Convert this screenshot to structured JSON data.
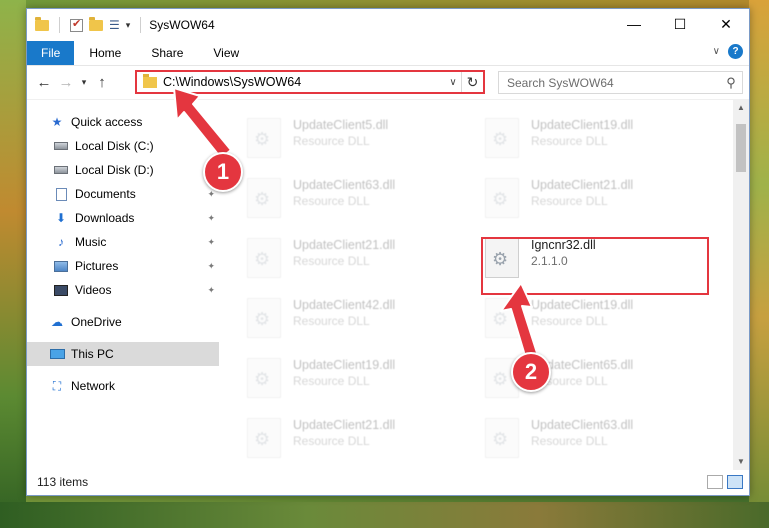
{
  "window": {
    "title": "SysWOW64",
    "minimize_glyph": "—",
    "maximize_glyph": "☐",
    "close_glyph": "✕"
  },
  "ribbon": {
    "tabs": [
      "File",
      "Home",
      "Share",
      "View"
    ],
    "help_glyph": "?",
    "expand_glyph": "∨"
  },
  "navbar": {
    "back_glyph": "←",
    "forward_glyph": "→",
    "recent_glyph": "▾",
    "up_glyph": "↑",
    "address": "C:\\Windows\\SysWOW64",
    "address_dropdown_glyph": "∨",
    "refresh_glyph": "↻",
    "search_placeholder": "Search SysWOW64",
    "search_glyph": "⚲"
  },
  "sidebar": {
    "quick_access": "Quick access",
    "items": [
      {
        "label": "Local Disk (C:)",
        "icon": "disk-icon"
      },
      {
        "label": "Local Disk (D:)",
        "icon": "disk-icon"
      },
      {
        "label": "Documents",
        "icon": "documents-icon",
        "pinned": true
      },
      {
        "label": "Downloads",
        "icon": "downloads-icon",
        "pinned": true
      },
      {
        "label": "Music",
        "icon": "music-icon",
        "pinned": true
      },
      {
        "label": "Pictures",
        "icon": "pictures-icon",
        "pinned": true
      },
      {
        "label": "Videos",
        "icon": "videos-icon",
        "pinned": true
      }
    ],
    "onedrive": "OneDrive",
    "this_pc": "This PC",
    "network": "Network",
    "pin_glyph": "✦"
  },
  "files": {
    "left_column": [
      {
        "name": "UpdateClient5.dll",
        "type": "Resource DLL"
      },
      {
        "name": "UpdateClient63.dll",
        "type": "Resource DLL"
      },
      {
        "name": "UpdateClient21.dll",
        "type": "Resource DLL"
      },
      {
        "name": "UpdateClient42.dll",
        "type": "Resource DLL"
      },
      {
        "name": "UpdateClient19.dll",
        "type": "Resource DLL"
      },
      {
        "name": "UpdateClient21.dll",
        "type": "Resource DLL"
      }
    ],
    "right_column": [
      {
        "name": "UpdateClient19.dll",
        "type": "Resource DLL"
      },
      {
        "name": "UpdateClient21.dll",
        "type": "Resource DLL"
      },
      {
        "name": "Igncnr32.dll",
        "type": "2.1.1.0"
      },
      {
        "name": "UpdateClient19.dll",
        "type": "Resource DLL"
      },
      {
        "name": "UpdateClient65.dll",
        "type": "Resource DLL"
      },
      {
        "name": "UpdateClient63.dll",
        "type": "Resource DLL"
      }
    ]
  },
  "status": {
    "item_count": "113 items"
  },
  "callouts": [
    "1",
    "2"
  ],
  "colors": {
    "accent": "#1979ca",
    "highlight": "#e4363f"
  }
}
